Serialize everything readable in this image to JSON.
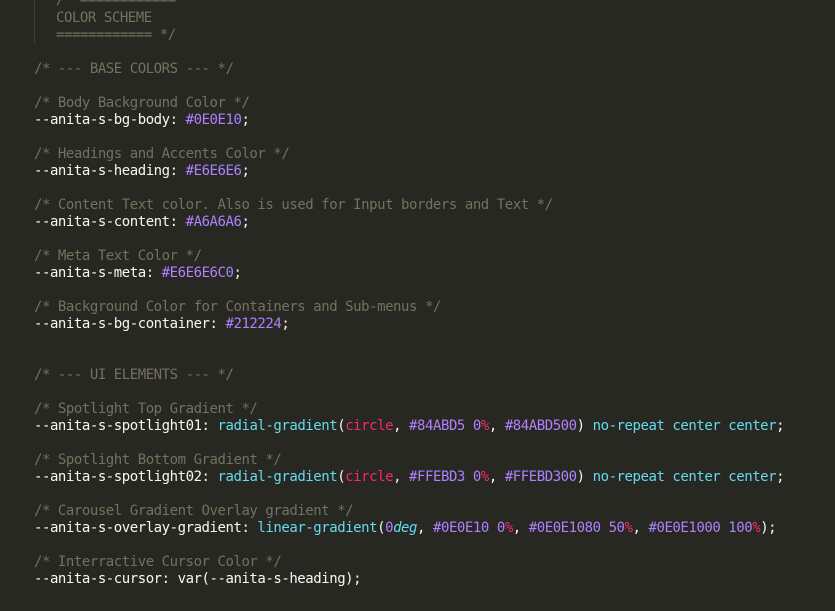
{
  "colors": {
    "background": "#272822",
    "comment": "#75715e",
    "property": "#f8f8f2",
    "constant": "#ae81ff",
    "function": "#66d9ef",
    "keyword_red": "#f92672"
  },
  "header": {
    "top_line": "/* ============",
    "title": "COLOR SCHEME",
    "close_line": "============ */"
  },
  "base_section": {
    "heading": "/* --- BASE COLORS --- */",
    "body_bg_comment": "/* Body Background Color */",
    "body_bg_prop": "--anita-s-bg-body:",
    "body_bg_value": "#0E0E10",
    "heading_comment": "/* Headings and Accents Color */",
    "heading_prop": "--anita-s-heading:",
    "heading_value": "#E6E6E6",
    "content_comment": "/* Content Text color. Also is used for Input borders and Text */",
    "content_prop": "--anita-s-content:",
    "content_value": "#A6A6A6",
    "meta_comment": "/* Meta Text Color */",
    "meta_prop": "--anita-s-meta:",
    "meta_value": "#E6E6E6C0",
    "container_comment": "/* Background Color for Containers and Sub-menus */",
    "container_prop": "--anita-s-bg-container:",
    "container_value": "#212224"
  },
  "ui_section": {
    "heading": "/* --- UI ELEMENTS --- */",
    "spot1_comment": "/* Spotlight Top Gradient */",
    "spot1_prop": "--anita-s-spotlight01:",
    "spot1_fn": "radial-gradient",
    "spot1_shape": "circle",
    "spot1_color1": "#84ABD5",
    "spot1_stop1": "0",
    "spot1_color2": "#84ABD500",
    "spot1_tail1": "no-repeat",
    "spot1_tail2": "center",
    "spot1_tail3": "center",
    "spot2_comment": "/* Spotlight Bottom Gradient */",
    "spot2_prop": "--anita-s-spotlight02:",
    "spot2_fn": "radial-gradient",
    "spot2_shape": "circle",
    "spot2_color1": "#FFEBD3",
    "spot2_stop1": "0",
    "spot2_color2": "#FFEBD300",
    "spot2_tail1": "no-repeat",
    "spot2_tail2": "center",
    "spot2_tail3": "center",
    "overlay_comment": "/* Carousel Gradient Overlay gradient */",
    "overlay_prop": "--anita-s-overlay-gradient:",
    "overlay_fn": "linear-gradient",
    "overlay_angle": "0",
    "overlay_angle_unit": "deg",
    "overlay_color1": "#0E0E10",
    "overlay_stop1": "0",
    "overlay_color2": "#0E0E1080",
    "overlay_stop2": "50",
    "overlay_color3": "#0E0E1000",
    "overlay_stop3": "100",
    "cursor_comment": "/* Interractive Cursor Color */",
    "cursor_prop": "--anita-s-cursor:",
    "cursor_value": "var(--anita-s-heading);"
  }
}
